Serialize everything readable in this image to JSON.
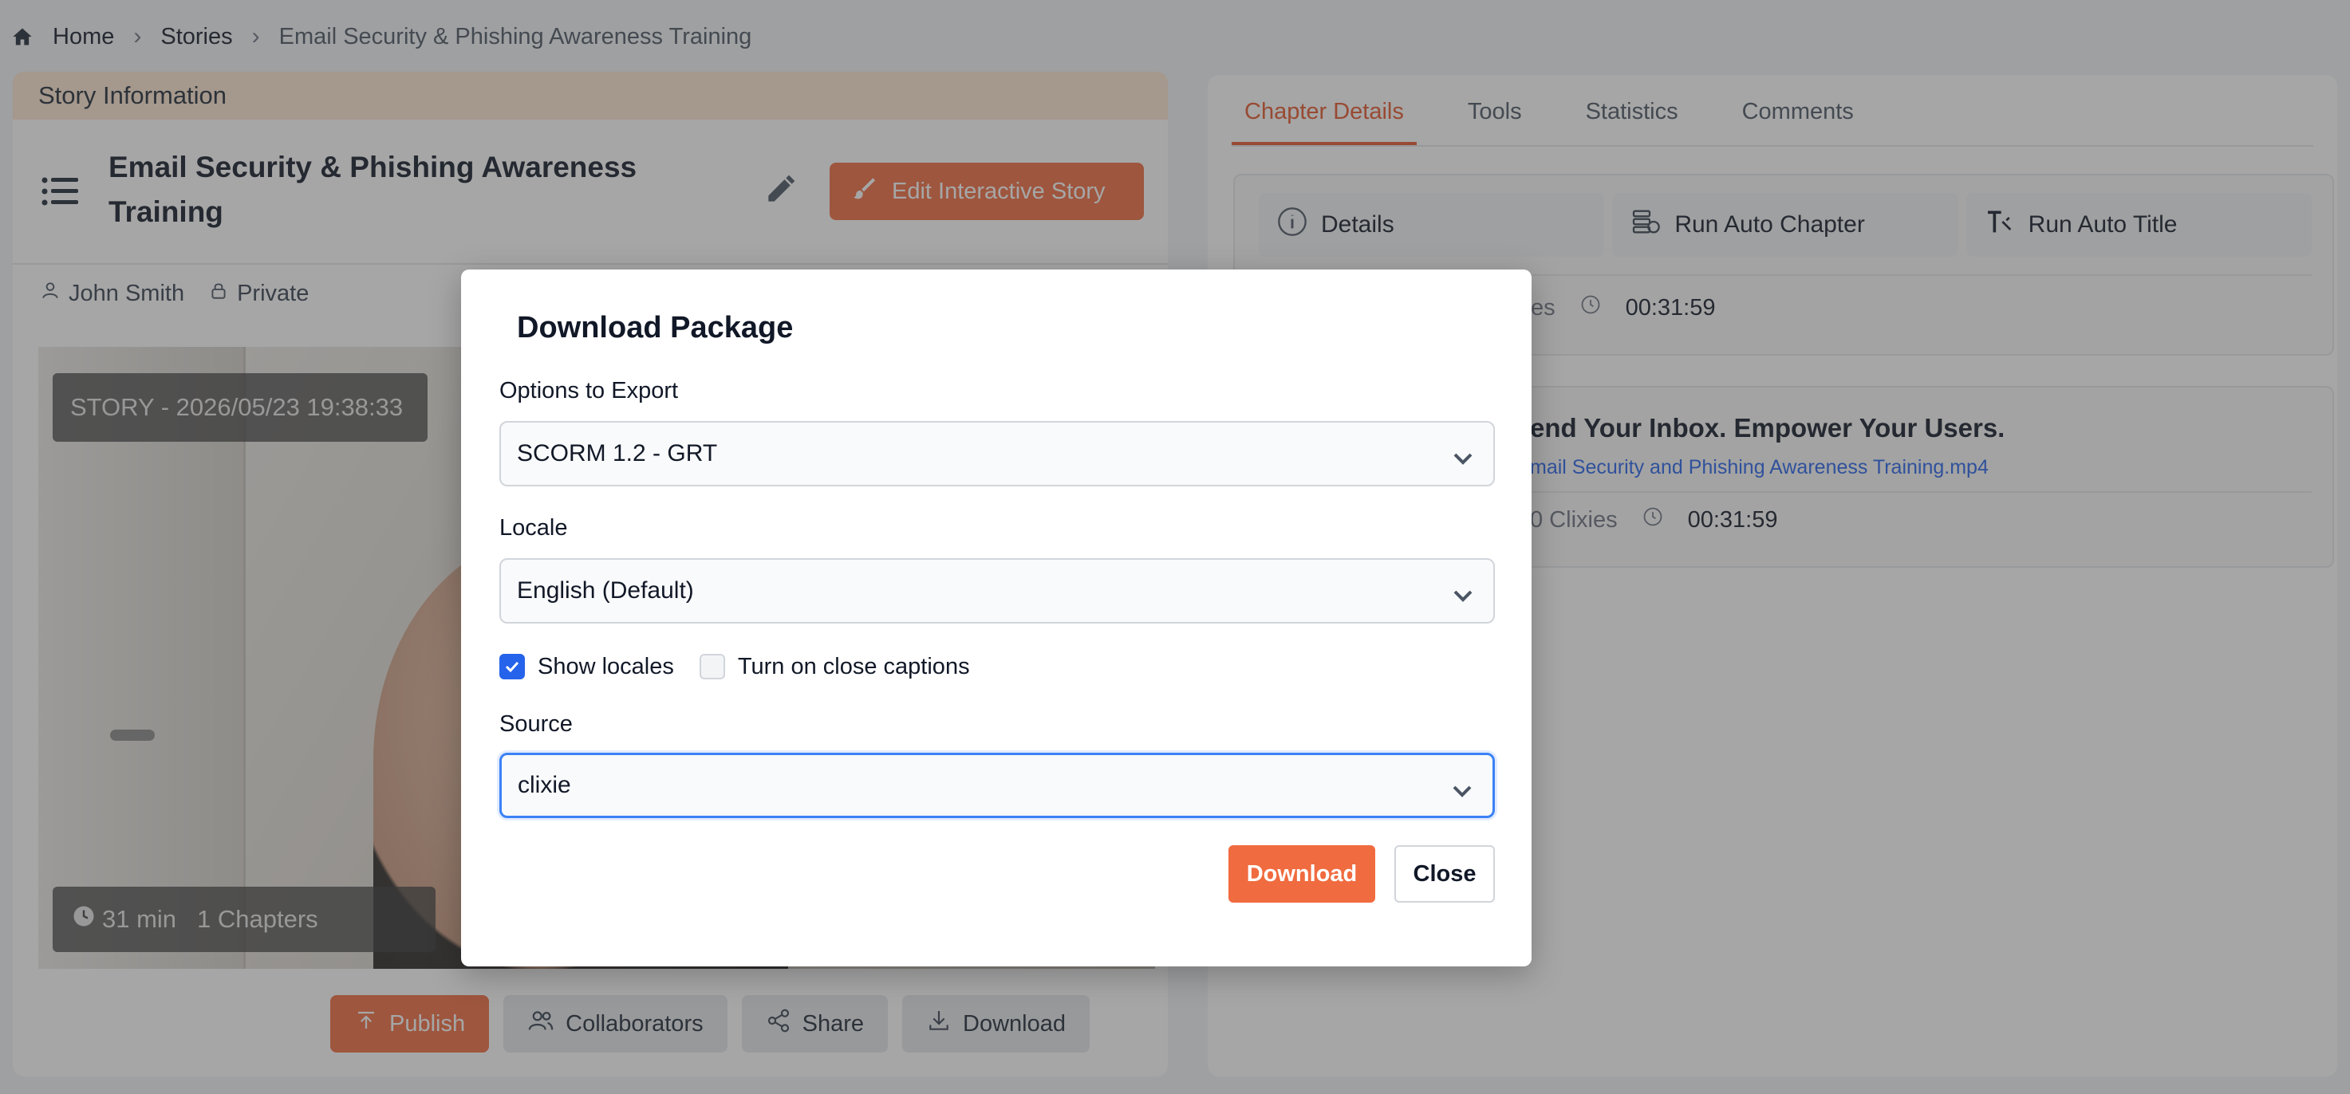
{
  "breadcrumb": {
    "home": "Home",
    "stories": "Stories",
    "current": "Email Security & Phishing Awareness Training"
  },
  "story_panel": {
    "header": "Story Information",
    "title": "Email Security & Phishing Awareness Training",
    "edit_button": "Edit Interactive Story",
    "owner": "John Smith",
    "visibility": "Private",
    "video_label": "STORY - 2026/05/23 19:38:33",
    "duration": "31 min",
    "chapters": "1 Chapters",
    "actions": {
      "publish": "Publish",
      "collaborators": "Collaborators",
      "share": "Share",
      "download": "Download"
    }
  },
  "right_panel": {
    "tabs": [
      "Chapter Details",
      "Tools",
      "Statistics",
      "Comments"
    ],
    "active_tab": "Chapter Details",
    "tools": {
      "details": "Details",
      "run_auto_chapter": "Run Auto Chapter",
      "run_auto_title": "Run Auto Title"
    },
    "card1": {
      "clixies_partial": "xies",
      "time": "00:31:59"
    },
    "card2": {
      "title_partial": "end Your Inbox. Empower Your Users.",
      "file_partial": "mail Security and Phishing Awareness Training.mp4",
      "clixies_partial": "0 Clixies",
      "time": "00:31:59"
    }
  },
  "modal": {
    "title": "Download Package",
    "options_label": "Options to Export",
    "options_value": "SCORM 1.2 - GRT",
    "locale_label": "Locale",
    "locale_value": "English (Default)",
    "show_locales": "Show locales",
    "show_locales_checked": true,
    "close_captions": "Turn on close captions",
    "close_captions_checked": false,
    "source_label": "Source",
    "source_value": "clixie",
    "download_button": "Download",
    "close_button": "Close"
  },
  "colors": {
    "accent": "#f06b3f",
    "active_tab": "#e5562c",
    "link": "#2563eb",
    "checkbox": "#2563eb",
    "header_band": "#fde6cf"
  }
}
